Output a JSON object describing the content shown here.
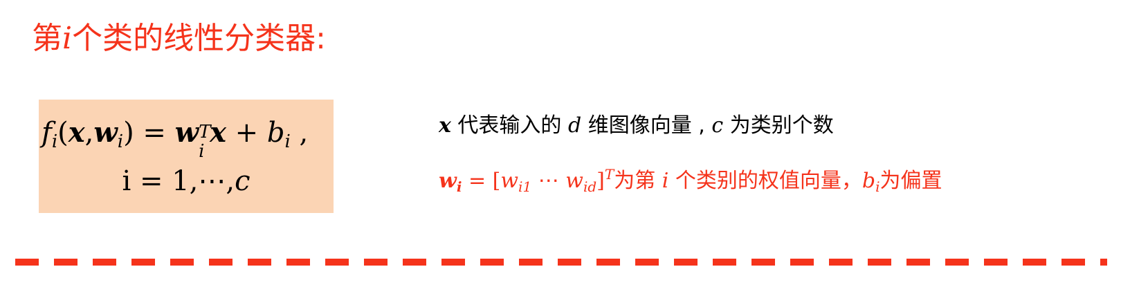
{
  "title": {
    "prefix": "第",
    "var": "i",
    "suffix": "个类的线性分类器:"
  },
  "formula": {
    "f": "f",
    "i": "i",
    "open": "(",
    "x": "x",
    "comma": ",",
    "w": "w",
    "close": ")",
    "eq": " = ",
    "T": "T",
    "plus": " + ",
    "b": "b",
    "trail": " ,",
    "line2": "i = 1,⋯,",
    "c": "c"
  },
  "description": {
    "line1": {
      "x": "x",
      "text_a": " 代表输入的 ",
      "d": "d",
      "text_b": " 维图像向量 , ",
      "c": "c",
      "text_c": " 为类别个数"
    },
    "line2": {
      "w": "w",
      "w_sub": "i",
      "eq": " = [",
      "w1": "w",
      "w1_sub": "i1",
      "dots": "    ⋯    ",
      "w2": "w",
      "w2_sub": "id",
      "close": "]",
      "T": "T",
      "text_a": "为第 ",
      "i": "i",
      "text_b": " 个类别的权值向量，",
      "b": "b",
      "b_sub": "i",
      "text_c": "为偏置"
    }
  },
  "colors": {
    "accent_red": "#f5331b",
    "box_fill": "#fbd4b4"
  }
}
